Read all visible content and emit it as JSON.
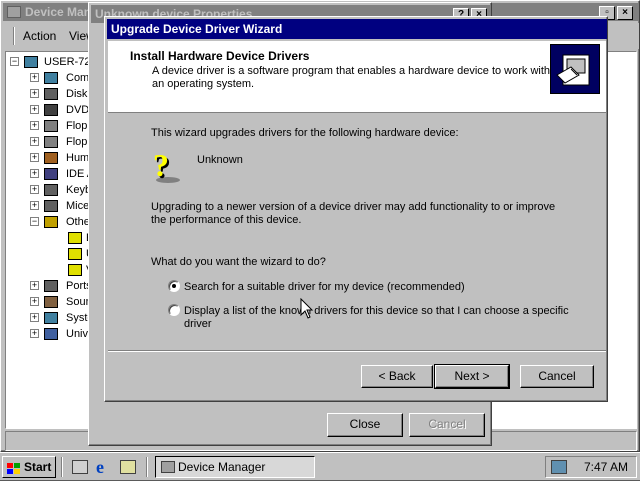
{
  "device_manager": {
    "title": "Device Manager",
    "menu": [
      "Action",
      "View"
    ],
    "tree": {
      "root": "USER-72",
      "items": [
        {
          "label": "Comp",
          "expander": "+"
        },
        {
          "label": "Disk d",
          "expander": "+"
        },
        {
          "label": "DVD/",
          "expander": "+"
        },
        {
          "label": "Flopp",
          "expander": "+"
        },
        {
          "label": "Flopp",
          "expander": "+"
        },
        {
          "label": "Huma",
          "expander": "+"
        },
        {
          "label": "IDE A",
          "expander": "+"
        },
        {
          "label": "Keyb",
          "expander": "+"
        },
        {
          "label": "Mice",
          "expander": "+"
        },
        {
          "label": "Othe",
          "expander": "−"
        },
        {
          "label": "E",
          "expander": ""
        },
        {
          "label": "U",
          "expander": ""
        },
        {
          "label": "V",
          "expander": ""
        },
        {
          "label": "Ports",
          "expander": "+"
        },
        {
          "label": "Soun",
          "expander": "+"
        },
        {
          "label": "Syste",
          "expander": "+"
        },
        {
          "label": "Unive",
          "expander": "+"
        }
      ]
    }
  },
  "properties": {
    "title": "Unknown device Properties",
    "close_label": "Close",
    "cancel_label": "Cancel"
  },
  "wizard": {
    "title": "Upgrade Device Driver Wizard",
    "header_title": "Install Hardware Device Drivers",
    "header_desc": "A device driver is a software program that enables a hardware device to work with an operating system.",
    "intro": "This wizard upgrades drivers for the following hardware device:",
    "device_name": "Unknown",
    "upgrade_text": "Upgrading to a newer version of a device driver may add functionality to or improve the performance of this device.",
    "question": "What do you want the wizard to do?",
    "option_search": "Search for a suitable driver for my device (recommended)",
    "option_list": "Display a list of the known drivers for this device so that I can choose a specific driver",
    "back_label": "< Back",
    "next_label": "Next >",
    "cancel_label": "Cancel"
  },
  "taskbar": {
    "start_label": "Start",
    "task_label": "Device Manager",
    "clock": "7:47 AM"
  }
}
